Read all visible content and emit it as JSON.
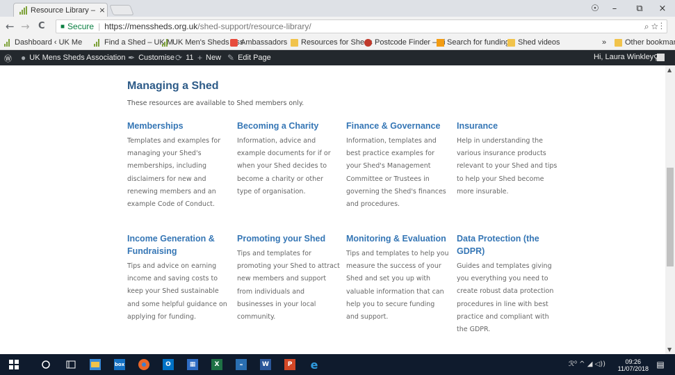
{
  "browser": {
    "tab_title": "Resource Library – UK Me",
    "tab_close": "×",
    "window_controls": {
      "account": "☉",
      "minimize": "–",
      "restore": "⧉",
      "close": "×"
    },
    "nav": {
      "back": "←",
      "forward": "→",
      "reload": "C"
    },
    "secure_label": "Secure",
    "url_host": "https://menssheds.org.uk",
    "url_path": "/shed-support/resource-library/",
    "omnibox_icons": "⌕ ☆ ⋮"
  },
  "bookmarks": [
    {
      "label": "Dashboard ‹ UK Me",
      "icon": "bars"
    },
    {
      "label": "Find a Shed – UK M",
      "icon": "bars"
    },
    {
      "label": "UK Men's Sheds Ass",
      "icon": "bars"
    },
    {
      "label": "Ambassadors",
      "icon": "red"
    },
    {
      "label": "Resources for Sheds",
      "icon": "folder"
    },
    {
      "label": "Postcode Finder – Fi",
      "icon": "db"
    },
    {
      "label": "Search for funding",
      "icon": "fc"
    },
    {
      "label": "Shed videos",
      "icon": "folder"
    }
  ],
  "bookmarks_overflow": "»",
  "other_bookmarks": "Other bookmarks",
  "adminbar": {
    "wp_logo": "Ⓦ",
    "site_name": "UK Mens Sheds Association",
    "customise": "Customise",
    "updates": "11",
    "new_label": "New",
    "edit_page": "Edit Page",
    "greeting": "Hi, Laura Winkley"
  },
  "main": {
    "title": "Managing a Shed",
    "intro": "These resources are available to Shed members only.",
    "cards": [
      {
        "title": "Memberships",
        "text": "Templates and examples for managing your Shed's memberships, including disclaimers for new and renewing members and an example Code of Conduct."
      },
      {
        "title": "Becoming a Charity",
        "text": "Information, advice and example documents for if or when your Shed decides to become a charity or other type of organisation."
      },
      {
        "title": "Finance & Governance",
        "text": "Information, templates and best practice examples for your Shed's Management Committee or Trustees in governing the Shed's finances and procedures."
      },
      {
        "title": "Insurance",
        "text": "Help in understanding the various insurance products relevant to your Shed and tips to help your Shed become more insurable."
      },
      {
        "title": "Income Generation & Fundraising",
        "text": "Tips and advice on earning income and saving costs to keep your Shed sustainable and some helpful guidance on applying for funding."
      },
      {
        "title": "Promoting your Shed",
        "text": "Tips and templates for promoting your Shed to attract new members and support from individuals and businesses in your local community."
      },
      {
        "title": "Monitoring & Evaluation",
        "text": "Tips and templates to help you measure the success of your Shed and set you up with valuable information that can help you to secure funding and support."
      },
      {
        "title": "Data Protection (the GDPR)",
        "text": "Guides and templates giving you everything you need to create robust data protection procedures in line with best practice and compliant with the GDPR."
      }
    ]
  },
  "taskbar": {
    "time": "09:26",
    "date": "11/07/2018",
    "tray_icons": "ℛ⁰  ^  ◢  ◁))"
  },
  "colors": {
    "heading": "#2d5b88",
    "card_title": "#3576b5",
    "admin_bar": "#23282d",
    "taskbar": "#0f1b2d"
  }
}
